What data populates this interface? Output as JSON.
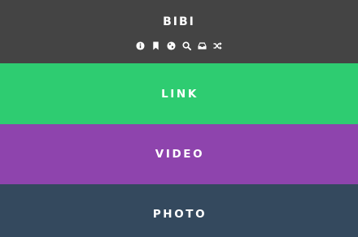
{
  "header": {
    "title": "BIBI",
    "background": "#444444",
    "icons": [
      "info-icon",
      "bookmark-icon",
      "globe-icon",
      "search-icon",
      "inbox-icon",
      "shuffle-icon"
    ]
  },
  "sections": [
    {
      "label": "LINK",
      "color": "#2ECC71"
    },
    {
      "label": "VIDEO",
      "color": "#8E44AD"
    },
    {
      "label": "PHOTO",
      "color": "#34495E"
    }
  ]
}
